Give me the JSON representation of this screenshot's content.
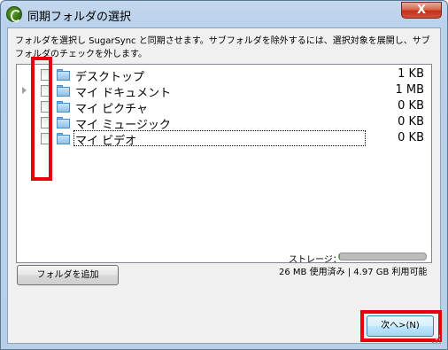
{
  "window": {
    "title": "同期フォルダの選択",
    "close_label": "X"
  },
  "description": "フォルダを選択し SugarSync と同期させます。サブフォルダを除外するには、選択対象を展開し、サブフォルダのチェックを外します。",
  "folders": [
    {
      "name": "デスクトップ",
      "size": "1 KB",
      "expandable": false,
      "checked": false
    },
    {
      "name": "マイ ドキュメント",
      "size": "1 MB",
      "expandable": true,
      "checked": false
    },
    {
      "name": "マイ ピクチャ",
      "size": "0 KB",
      "expandable": false,
      "checked": false
    },
    {
      "name": "マイ ミュージック",
      "size": "0 KB",
      "expandable": false,
      "checked": false
    },
    {
      "name": "マイ ビデオ",
      "size": "0 KB",
      "expandable": false,
      "checked": false,
      "focused": true
    }
  ],
  "storage": {
    "label": "ストレージ：",
    "used_fraction": 0.005,
    "usage_text": "26 MB 使用済み | 4.97 GB 利用可能"
  },
  "buttons": {
    "add_folder": "フォルダを追加",
    "next": "次へ>(N)"
  },
  "colors": {
    "highlight": "#e8000c",
    "titlebar": "#bad1ea",
    "close_button": "#c1321a",
    "folder": "#8fc1e8"
  },
  "icons": [
    "sugarsync-app-icon",
    "folder-icon",
    "expand-arrow-icon",
    "resize-grip-icon"
  ]
}
